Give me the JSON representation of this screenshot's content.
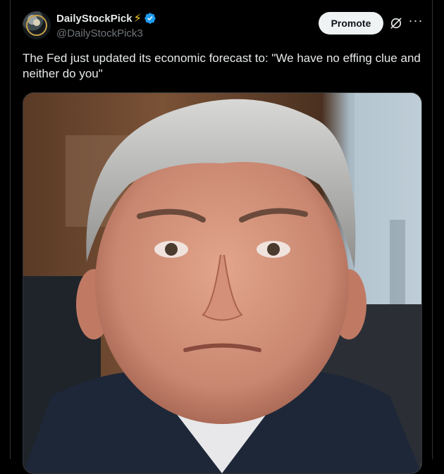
{
  "tweet": {
    "display_name": "DailyStockPick",
    "name_emoji": "⚡",
    "handle": "@DailyStockPick3",
    "text": "The Fed just updated its economic forecast to:  \"We have no effing clue and neither do you\""
  },
  "actions": {
    "promote_label": "Promote",
    "more_label": "···"
  },
  "icons": {
    "verified": "verified-badge-icon",
    "grok": "grok-icon",
    "more": "more-icon"
  },
  "colors": {
    "background": "#000000",
    "text": "#e7e9ea",
    "secondary_text": "#71767b",
    "verified": "#1d9bf0",
    "promote_bg": "#eff3f4",
    "bolt": "#ffd21e"
  }
}
